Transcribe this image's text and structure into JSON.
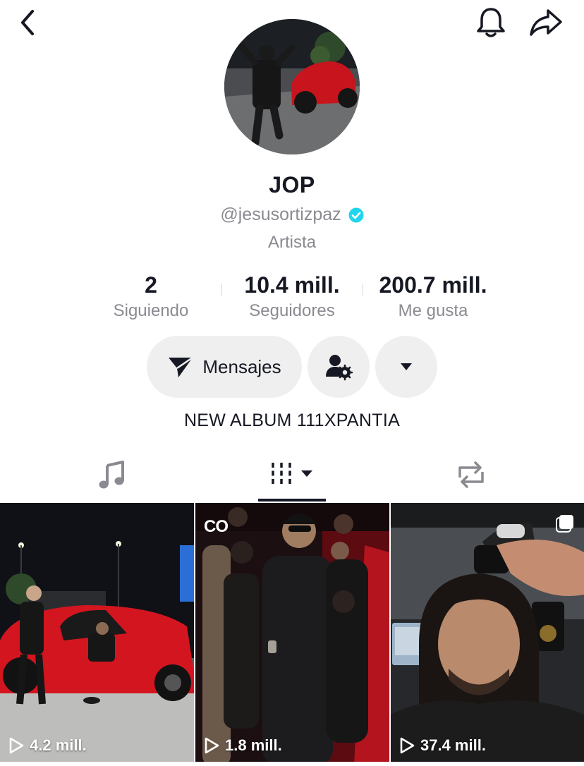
{
  "profile": {
    "name": "JOP",
    "handle": "@jesusortizpaz",
    "category": "Artista",
    "bio": "NEW ALBUM 111XPANTIA"
  },
  "stats": {
    "following": {
      "value": "2",
      "label": "Siguiendo"
    },
    "followers": {
      "value": "10.4 mill.",
      "label": "Seguidores"
    },
    "likes": {
      "value": "200.7 mill.",
      "label": "Me gusta"
    }
  },
  "actions": {
    "message_label": "Mensajes"
  },
  "videos": [
    {
      "views": "4.2 mill."
    },
    {
      "views": "1.8 mill.",
      "badge": "CO"
    },
    {
      "views": "37.4 mill."
    }
  ],
  "colors": {
    "verified": "#20d5ec",
    "text_primary": "#161823",
    "text_secondary": "#8a8b91",
    "button_bg": "#efefef"
  },
  "icons": [
    "back-icon",
    "bell-icon",
    "share-icon",
    "send-icon",
    "user-settings-icon",
    "caret-down-icon",
    "music-icon",
    "videos-grid-icon",
    "repost-icon",
    "play-icon"
  ]
}
